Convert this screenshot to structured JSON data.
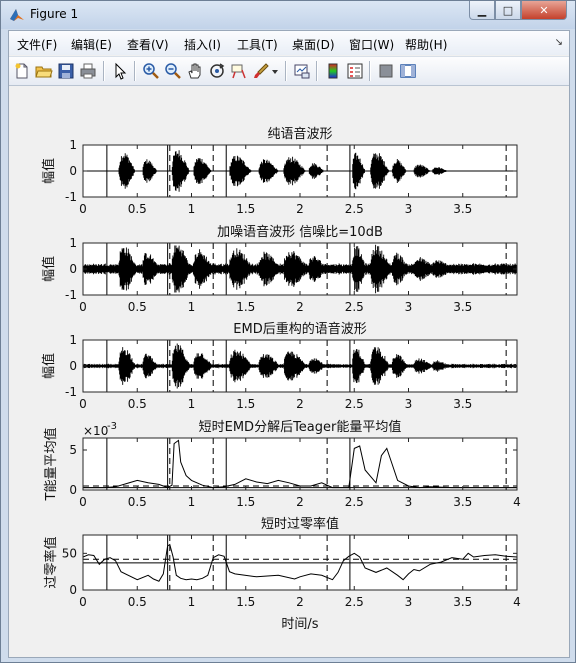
{
  "window": {
    "title": "Figure 1",
    "buttons": {
      "minimize": "▁",
      "maximize": "□",
      "close": "✕"
    }
  },
  "menu": [
    {
      "label": "文件(F)"
    },
    {
      "label": "编辑(E)"
    },
    {
      "label": "查看(V)"
    },
    {
      "label": "插入(I)"
    },
    {
      "label": "工具(T)"
    },
    {
      "label": "桌面(D)"
    },
    {
      "label": "窗口(W)"
    },
    {
      "label": "帮助(H)"
    }
  ],
  "toolbar": [
    "new-figure-icon",
    "open-file-icon",
    "save-icon",
    "print-icon",
    "pointer-icon",
    "zoom-in-icon",
    "zoom-out-icon",
    "pan-hand-icon",
    "rotate-3d-icon",
    "data-cursor-icon",
    "brush-icon",
    "link-plot-icon",
    "colorbar-icon",
    "legend-icon",
    "hide-plot-tools-icon",
    "show-plot-tools-icon"
  ],
  "chart_data": [
    {
      "type": "line",
      "title": "纯语音波形",
      "ylabel": "幅值",
      "xlabel": "",
      "xlim": [
        0,
        4
      ],
      "ylim": [
        -1,
        1
      ],
      "xticks": [
        "0",
        "0.5",
        "1",
        "1.5",
        "2",
        "2.5",
        "3",
        "3.5"
      ],
      "yticks": [
        "1",
        "0",
        "-1"
      ],
      "signal": "speech waveform, bursts between boundaries"
    },
    {
      "type": "line",
      "title": "加噪语音波形 信噪比=10dB",
      "ylabel": "幅值",
      "xlabel": "",
      "xlim": [
        0,
        4
      ],
      "ylim": [
        -1,
        1
      ],
      "xticks": [
        "0",
        "0.5",
        "1",
        "1.5",
        "2",
        "2.5",
        "3",
        "3.5"
      ],
      "yticks": [
        "1",
        "0",
        "-1"
      ]
    },
    {
      "type": "line",
      "title": "EMD后重构的语音波形",
      "ylabel": "幅值",
      "xlabel": "",
      "xlim": [
        0,
        4
      ],
      "ylim": [
        -1,
        1
      ],
      "xticks": [
        "0",
        "0.5",
        "1",
        "1.5",
        "2",
        "2.5",
        "3",
        "3.5"
      ],
      "yticks": [
        "1",
        "0",
        "-1"
      ]
    },
    {
      "type": "line",
      "title": "短时EMD分解后Teager能量平均值",
      "ylabel": "T能量平均值",
      "xlabel": "",
      "xlim": [
        0,
        4
      ],
      "ylim": [
        0,
        0.0065
      ],
      "exponent_label": "×10",
      "exponent_power": "-3",
      "xticks": [
        "0",
        "0.5",
        "1",
        "1.5",
        "2",
        "2.5",
        "3",
        "3.5",
        "4"
      ],
      "yticks": [
        "5",
        "0"
      ],
      "threshold_solid": 0.0003,
      "threshold_dashed": 0.0005,
      "x": [
        0,
        0.2,
        0.3,
        0.4,
        0.5,
        0.6,
        0.7,
        0.78,
        0.82,
        0.84,
        0.88,
        0.9,
        0.95,
        1.0,
        1.1,
        1.2,
        1.3,
        1.4,
        1.5,
        1.6,
        1.7,
        1.8,
        1.9,
        2.0,
        2.1,
        2.2,
        2.3,
        2.45,
        2.5,
        2.55,
        2.6,
        2.7,
        2.75,
        2.8,
        2.85,
        2.9,
        3.0,
        3.1,
        3.2,
        3.4,
        3.6,
        3.9,
        4.0
      ],
      "values": [
        0.0003,
        0.0003,
        0.0004,
        0.0008,
        0.0012,
        0.0009,
        0.0007,
        0.0003,
        0.0006,
        0.0058,
        0.0062,
        0.0035,
        0.0018,
        0.0012,
        0.0006,
        0.0003,
        0.0004,
        0.0007,
        0.0014,
        0.001,
        0.0008,
        0.0012,
        0.0009,
        0.0005,
        0.0005,
        0.0009,
        0.0003,
        0.0003,
        0.0052,
        0.0055,
        0.0025,
        0.0009,
        0.0043,
        0.0052,
        0.0032,
        0.0012,
        0.0005,
        0.0003,
        0.0004,
        0.0003,
        0.0003,
        0.0003,
        0.0003
      ]
    },
    {
      "type": "line",
      "title": "短时过零率值",
      "ylabel": "过零率值",
      "xlabel": "时间/s",
      "xlim": [
        0,
        4
      ],
      "ylim": [
        0,
        75
      ],
      "xticks": [
        "0",
        "0.5",
        "1",
        "1.5",
        "2",
        "2.5",
        "3",
        "3.5",
        "4"
      ],
      "yticks": [
        "50",
        "0"
      ],
      "threshold_solid": 37,
      "threshold_dashed": 42,
      "x": [
        0,
        0.05,
        0.1,
        0.15,
        0.2,
        0.25,
        0.3,
        0.35,
        0.5,
        0.6,
        0.65,
        0.7,
        0.74,
        0.78,
        0.8,
        0.83,
        0.86,
        0.9,
        0.95,
        1.0,
        1.05,
        1.1,
        1.15,
        1.2,
        1.25,
        1.3,
        1.35,
        1.4,
        1.6,
        1.8,
        1.95,
        2.0,
        2.1,
        2.2,
        2.3,
        2.35,
        2.4,
        2.45,
        2.5,
        2.55,
        2.6,
        2.7,
        2.8,
        2.9,
        2.95,
        3.0,
        3.05,
        3.1,
        3.2,
        3.3,
        3.4,
        3.5,
        3.55,
        3.6,
        3.7,
        3.8,
        3.9,
        4.0
      ],
      "values": [
        45,
        48,
        47,
        35,
        42,
        44,
        40,
        25,
        14,
        20,
        15,
        12,
        22,
        60,
        62,
        45,
        20,
        16,
        14,
        15,
        14,
        16,
        20,
        44,
        48,
        46,
        25,
        22,
        18,
        20,
        15,
        18,
        22,
        20,
        14,
        24,
        40,
        46,
        50,
        45,
        30,
        24,
        30,
        20,
        14,
        22,
        28,
        26,
        35,
        38,
        44,
        42,
        50,
        45,
        47,
        48,
        46,
        45
      ]
    }
  ],
  "event_markers": {
    "solid": [
      0.22,
      0.78,
      1.32,
      2.46
    ],
    "dashed": [
      0.8,
      1.2,
      2.25,
      3.9
    ]
  }
}
